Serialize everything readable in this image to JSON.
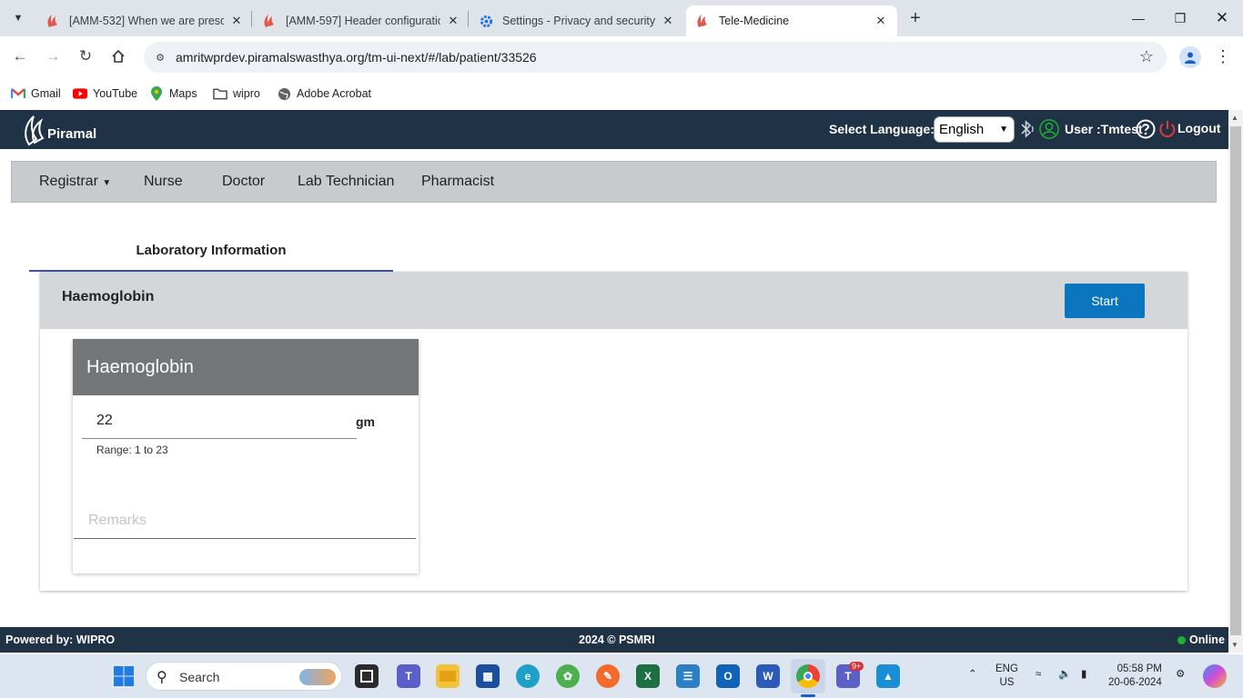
{
  "browser": {
    "tabs": [
      {
        "title": "[AMM-532] When we are presc",
        "active": false
      },
      {
        "title": "[AMM-597] Header configuratio",
        "active": false
      },
      {
        "title": "Settings - Privacy and security",
        "active": false
      },
      {
        "title": "Tele-Medicine",
        "active": true
      }
    ],
    "url": "amritwprdev.piramalswasthya.org/tm-ui-next/#/lab/patient/33526",
    "bookmarks": [
      "Gmail",
      "YouTube",
      "Maps",
      "wipro",
      "Adobe Acrobat"
    ]
  },
  "header": {
    "logo_text": "Piramal",
    "select_language_label": "Select Language:",
    "language_value": "English",
    "user_label": "User :Tmtest",
    "logout_label": "Logout"
  },
  "roles": {
    "registrar": "Registrar",
    "nurse": "Nurse",
    "doctor": "Doctor",
    "lab_technician": "Lab Technician",
    "pharmacist": "Pharmacist"
  },
  "content": {
    "tab_label": "Laboratory Information",
    "panel_title": "Haemoglobin",
    "start_label": "Start",
    "card": {
      "title": "Haemoglobin",
      "value": "22",
      "unit": "gm",
      "range": "Range: 1 to 23",
      "remarks_placeholder": "Remarks"
    }
  },
  "footer": {
    "powered_by": "Powered by: WIPRO",
    "copyright": "2024 © PSMRI",
    "status": "Online"
  },
  "taskbar": {
    "search_label": "Search",
    "lang_top": "ENG",
    "lang_bottom": "US",
    "time": "05:58 PM",
    "date": "20-06-2024",
    "teams_badge": "9+"
  },
  "colors": {
    "header_bg": "#1f3246",
    "start_button": "#0b75c0",
    "tab_underline": "#3f51b5",
    "card_header": "#737576",
    "online_dot": "#1db233"
  }
}
